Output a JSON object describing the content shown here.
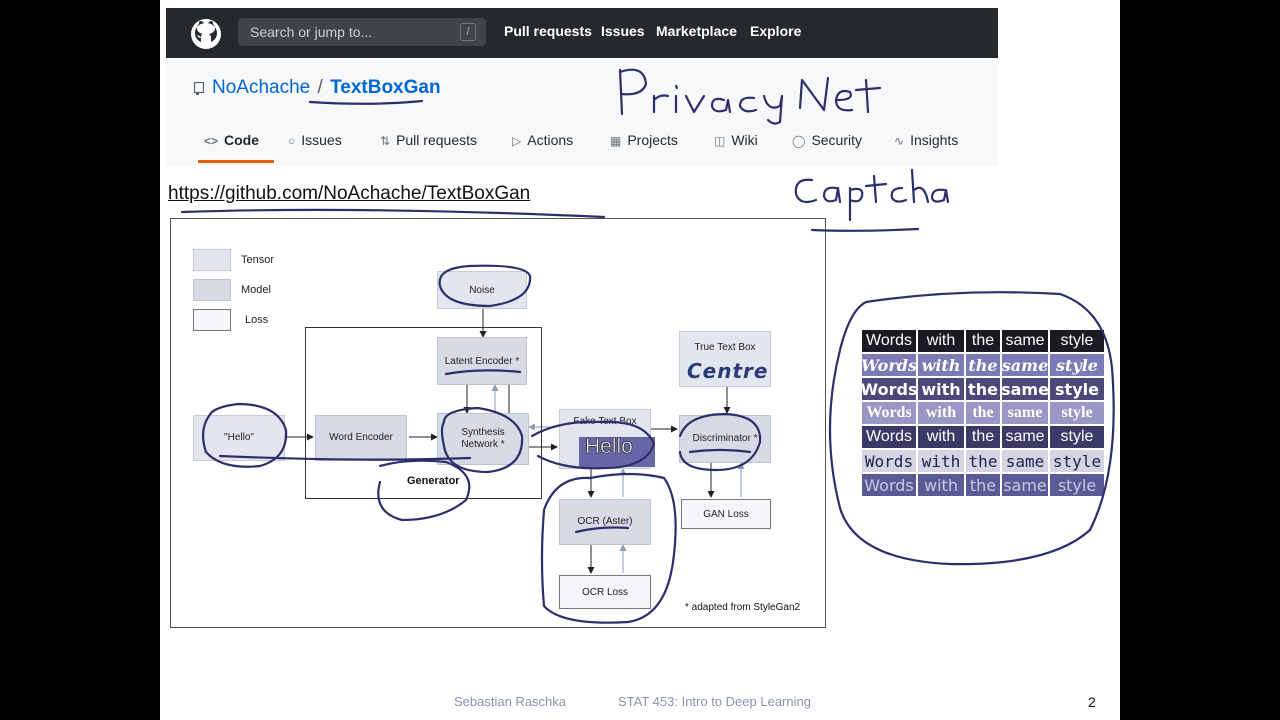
{
  "github": {
    "search_placeholder": "Search or jump to...",
    "search_shortcut": "/",
    "nav": [
      "Pull requests",
      "Issues",
      "Marketplace",
      "Explore"
    ]
  },
  "repo": {
    "owner": "NoAchache",
    "separator": "/",
    "name": "TextBoxGan",
    "tabs": [
      "Code",
      "Issues",
      "Pull requests",
      "Actions",
      "Projects",
      "Wiki",
      "Security",
      "Insights"
    ],
    "active_tab": "Code",
    "url": "https://github.com/NoAchache/TextBoxGan"
  },
  "diagram": {
    "legend": [
      "Tensor",
      "Model",
      "Loss"
    ],
    "nodes": {
      "noise": "Noise",
      "latent_encoder": "Latent Encoder *",
      "hello_input": "\"Hello\"",
      "word_encoder": "Word Encoder",
      "synthesis_network_line1": "Synthesis",
      "synthesis_network_line2": "Network *",
      "fake_text_box": "Fake Text Box",
      "fake_text_sample": "Hello",
      "true_text_box": "True Text Box",
      "true_text_sample": "Centre",
      "discriminator": "Discriminator *",
      "ocr": "OCR (Aster)",
      "ocr_loss": "OCR Loss",
      "gan_loss": "GAN Loss"
    },
    "generator_label": "Generator",
    "footnote": "* adapted from StyleGan2"
  },
  "style_examples": {
    "words": [
      "Words",
      "with",
      "the",
      "same",
      "style"
    ],
    "rows": 7
  },
  "handwritten": {
    "note1": "Privacy Net",
    "note2": "Captcha"
  },
  "footer": {
    "author": "Sebastian Raschka",
    "course": "STAT 453: Intro to Deep Learning",
    "page": "2"
  }
}
